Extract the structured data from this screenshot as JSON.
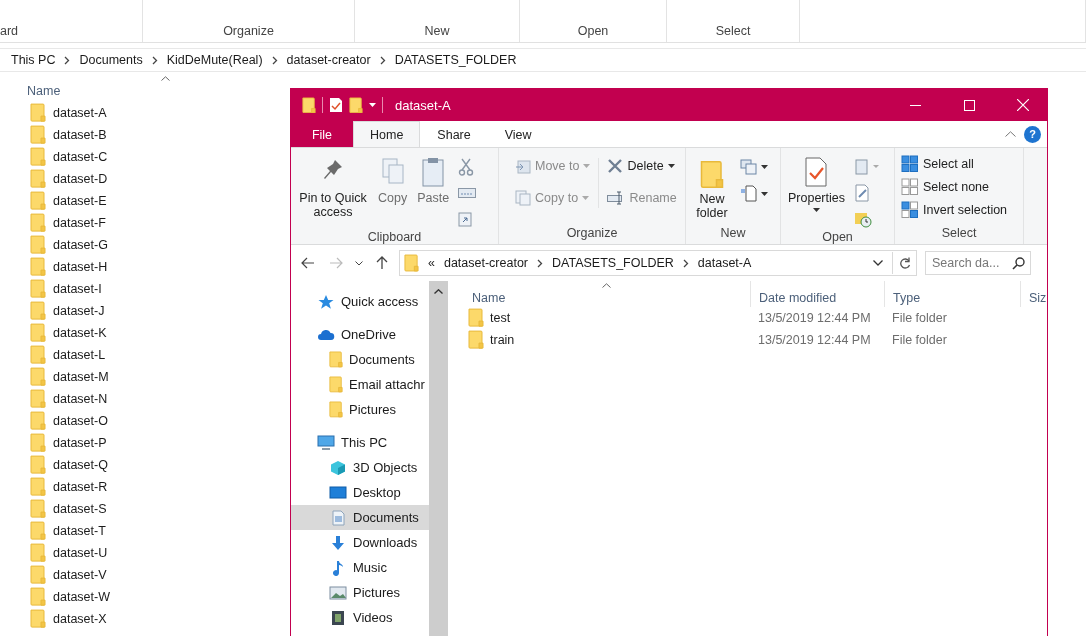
{
  "background_window": {
    "ribbon_groups": [
      "ard",
      "Organize",
      "New",
      "Open",
      "Select"
    ],
    "breadcrumb": [
      "This PC",
      "Documents",
      "KidDeMute(Real)",
      "dataset-creator",
      "DATASETS_FOLDER"
    ],
    "column": "Name",
    "items": [
      "dataset-A",
      "dataset-B",
      "dataset-C",
      "dataset-D",
      "dataset-E",
      "dataset-F",
      "dataset-G",
      "dataset-H",
      "dataset-I",
      "dataset-J",
      "dataset-K",
      "dataset-L",
      "dataset-M",
      "dataset-N",
      "dataset-O",
      "dataset-P",
      "dataset-Q",
      "dataset-R",
      "dataset-S",
      "dataset-T",
      "dataset-U",
      "dataset-V",
      "dataset-W",
      "dataset-X"
    ]
  },
  "window": {
    "title": "dataset-A",
    "tabs": [
      {
        "label": "File",
        "kind": "file",
        "selected": false
      },
      {
        "label": "Home",
        "kind": "tab",
        "selected": true
      },
      {
        "label": "Share",
        "kind": "tab",
        "selected": false
      },
      {
        "label": "View",
        "kind": "tab",
        "selected": false
      }
    ],
    "help": "?",
    "ribbon": {
      "clipboard": {
        "label": "Clipboard",
        "pin": {
          "label": "Pin to Quick access",
          "disabled": false
        },
        "copy": {
          "label": "Copy",
          "disabled": true
        },
        "paste": {
          "label": "Paste",
          "disabled": true
        }
      },
      "organize": {
        "label": "Organize",
        "move_to": {
          "label": "Move to",
          "disabled": true
        },
        "copy_to": {
          "label": "Copy to",
          "disabled": true
        },
        "delete": {
          "label": "Delete",
          "disabled": false
        },
        "rename": {
          "label": "Rename",
          "disabled": true
        }
      },
      "new": {
        "label": "New",
        "new_folder": "New folder"
      },
      "open": {
        "label": "Open",
        "properties": "Properties"
      },
      "select": {
        "label": "Select",
        "items": [
          "Select all",
          "Select none",
          "Invert selection"
        ]
      }
    },
    "address": {
      "overflow": "«",
      "breadcrumb": [
        "dataset-creator",
        "DATASETS_FOLDER",
        "dataset-A"
      ]
    },
    "search": {
      "placeholder": "Search da..."
    },
    "navigation": [
      {
        "label": "Quick access",
        "kind": "star",
        "selected": false
      },
      {
        "label": "OneDrive",
        "kind": "cloud",
        "selected": false,
        "children": [
          {
            "label": "Documents",
            "kind": "folder",
            "selected": false
          },
          {
            "label": "Email attachr",
            "kind": "folder",
            "selected": false
          },
          {
            "label": "Pictures",
            "kind": "folder",
            "selected": false
          }
        ]
      },
      {
        "label": "This PC",
        "kind": "pc",
        "selected": false,
        "children": [
          {
            "label": "3D Objects",
            "kind": "cube",
            "selected": false
          },
          {
            "label": "Desktop",
            "kind": "desktop",
            "selected": false
          },
          {
            "label": "Documents",
            "kind": "document",
            "selected": true
          },
          {
            "label": "Downloads",
            "kind": "download",
            "selected": false
          },
          {
            "label": "Music",
            "kind": "music",
            "selected": false
          },
          {
            "label": "Pictures",
            "kind": "picture",
            "selected": false
          },
          {
            "label": "Videos",
            "kind": "video",
            "selected": false
          }
        ]
      }
    ],
    "columns": [
      "Name",
      "Date modified",
      "Type",
      "Siz"
    ],
    "rows": [
      {
        "name": "test",
        "date": "13/5/2019 12:44 PM",
        "type": "File folder"
      },
      {
        "name": "train",
        "date": "13/5/2019 12:44 PM",
        "type": "File folder"
      }
    ]
  }
}
